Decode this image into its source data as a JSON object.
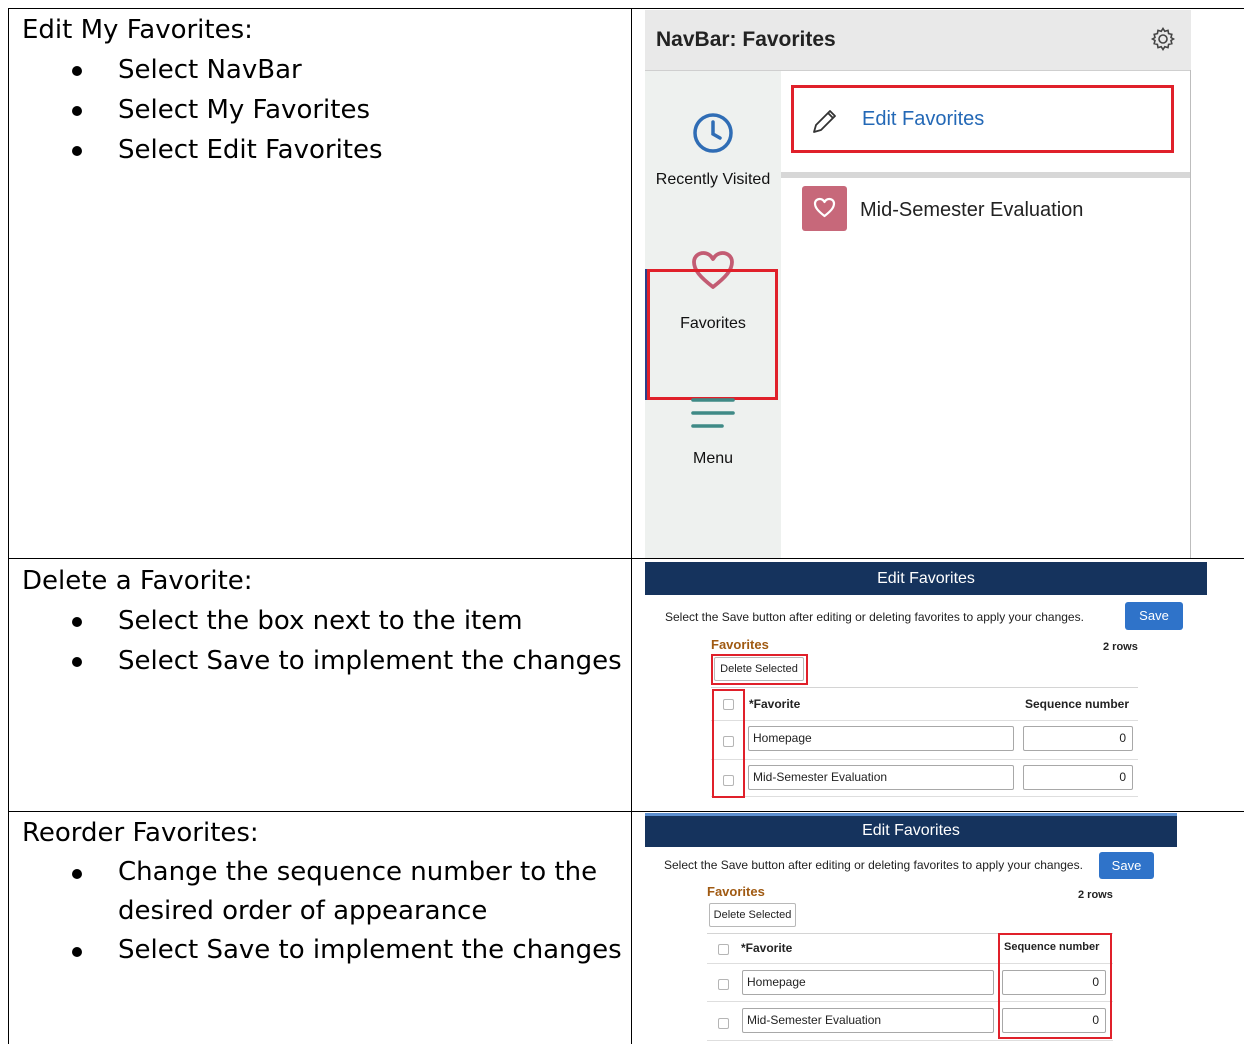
{
  "rows": [
    {
      "heading": "Edit My Favorites:",
      "bullets": [
        "Select NavBar",
        "Select My Favorites",
        "Select Edit Favorites"
      ]
    },
    {
      "heading": "Delete a Favorite:",
      "bullets": [
        "Select the box next to the item",
        "Select Save to implement the changes"
      ]
    },
    {
      "heading": "Reorder Favorites:",
      "bullets": [
        "Change the sequence number to the desired order of appearance",
        "Select Save to implement the changes"
      ]
    }
  ],
  "navbar": {
    "title": "NavBar: Favorites",
    "side_items": [
      "Recently Visited",
      "Favorites",
      "Menu"
    ],
    "edit_favorites_label": "Edit Favorites",
    "favorite_item": "Mid-Semester Evaluation"
  },
  "edit_panel_1": {
    "header": "Edit Favorites",
    "instruction": "Select the Save button after editing or deleting favorites to apply your changes.",
    "save_label": "Save",
    "section_title": "Favorites",
    "row_count": "2 rows",
    "delete_label": "Delete Selected",
    "col_favorite": "*Favorite",
    "col_sequence": "Sequence number",
    "items": [
      {
        "favorite": "Homepage",
        "sequence": "0"
      },
      {
        "favorite": "Mid-Semester Evaluation",
        "sequence": "0"
      }
    ]
  },
  "edit_panel_2": {
    "header": "Edit Favorites",
    "instruction": "Select the Save button after editing or deleting favorites to apply your changes.",
    "save_label": "Save",
    "section_title": "Favorites",
    "row_count": "2 rows",
    "delete_label": "Delete Selected",
    "col_favorite": "*Favorite",
    "col_sequence": "Sequence number",
    "items": [
      {
        "favorite": "Homepage",
        "sequence": "0"
      },
      {
        "favorite": "Mid-Semester Evaluation",
        "sequence": "0"
      }
    ]
  },
  "colors": {
    "header_navy": "#15335d",
    "save_blue": "#2f73c9",
    "highlight_red": "#e0202a",
    "link_blue": "#2368b6",
    "favorite_pink": "#c7687a",
    "icon_teal": "#3f8a86"
  }
}
